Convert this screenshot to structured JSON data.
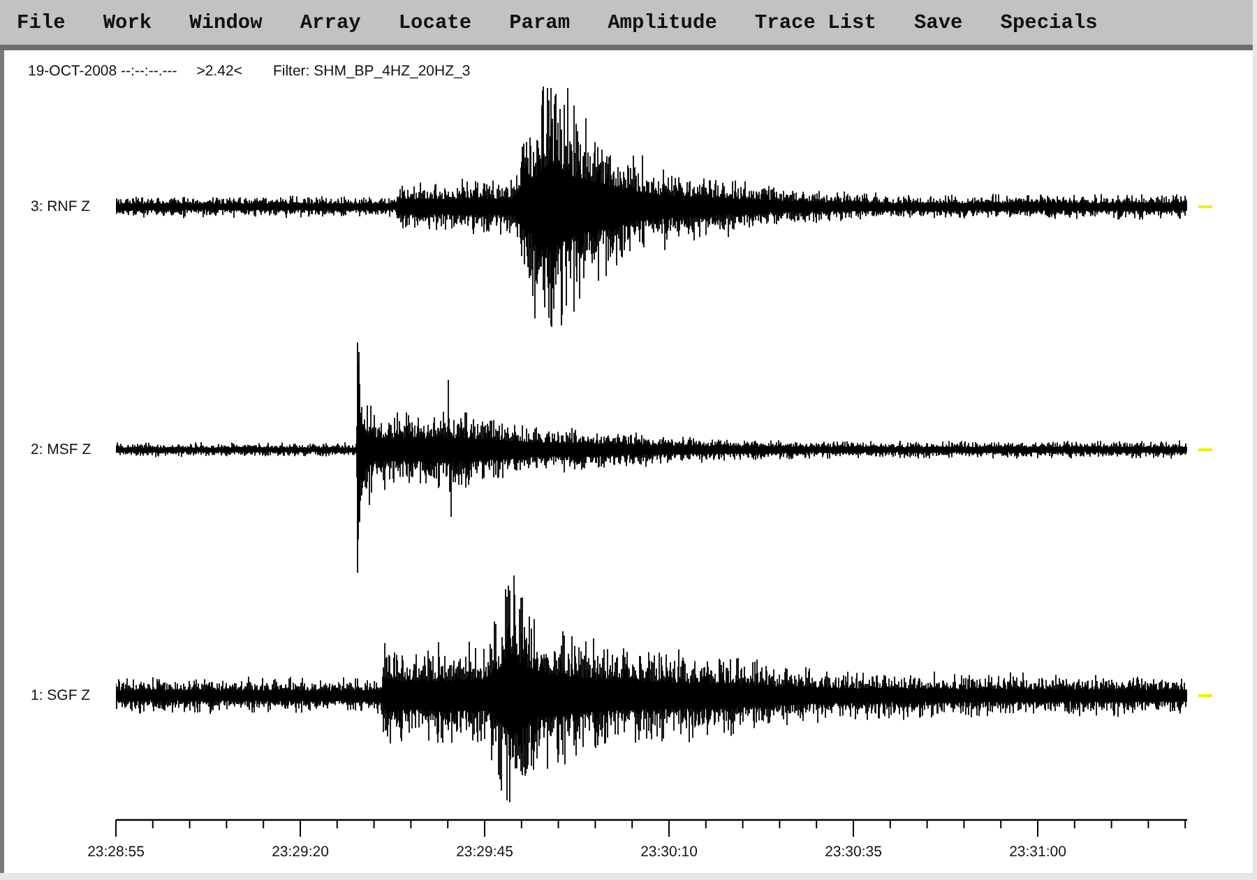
{
  "menu": [
    {
      "label": "File"
    },
    {
      "label": "Work"
    },
    {
      "label": "Window"
    },
    {
      "label": "Array"
    },
    {
      "label": "Locate"
    },
    {
      "label": "Param"
    },
    {
      "label": "Amplitude"
    },
    {
      "label": "Trace List"
    },
    {
      "label": "Save"
    },
    {
      "label": "Specials"
    }
  ],
  "info": {
    "date_time": "19-OCT-2008 --:--:--.---",
    "amplitude": ">2.42<",
    "filter": "Filter: SHM_BP_4HZ_20HZ_3"
  },
  "traces": [
    {
      "label": "3: RNF Z"
    },
    {
      "label": "2: MSF Z"
    },
    {
      "label": "1: SGF Z"
    }
  ],
  "time_axis": {
    "labels": [
      "23:28:55",
      "23:29:20",
      "23:29:45",
      "23:30:10",
      "23:30:35",
      "23:31:00"
    ]
  }
}
